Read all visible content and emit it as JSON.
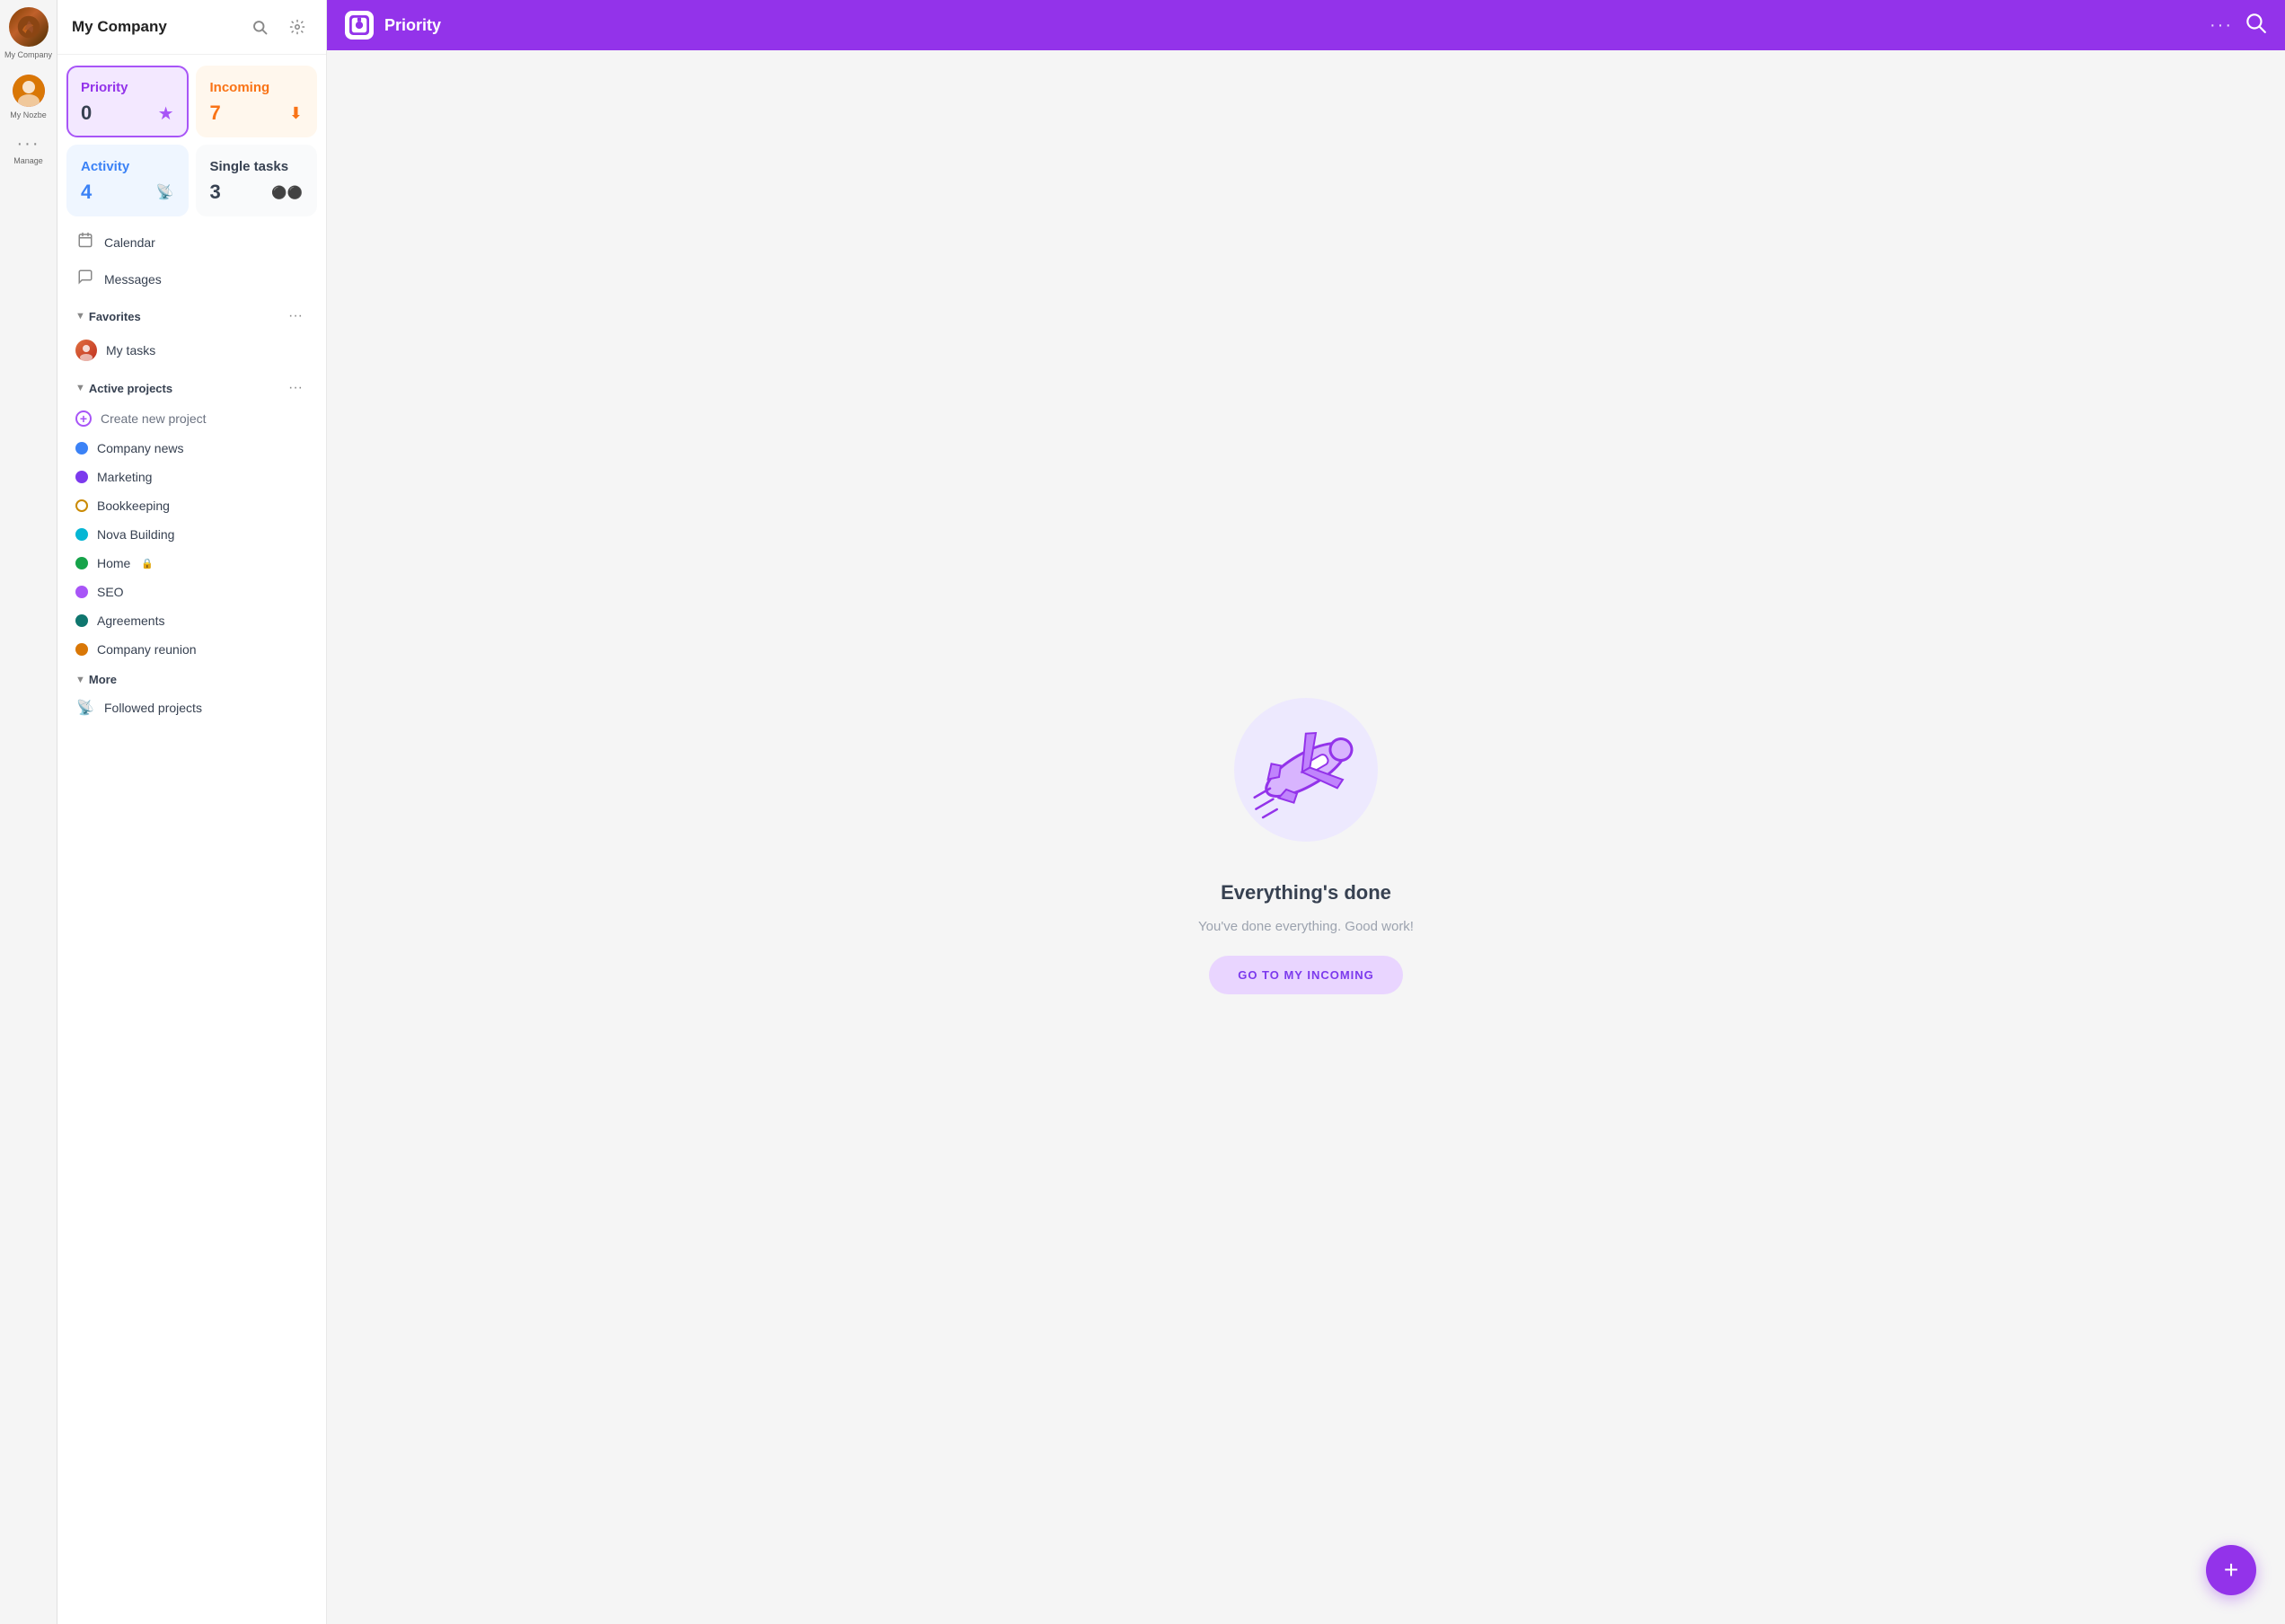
{
  "rail": {
    "company_label": "My Company",
    "user_label": "My Nozbe",
    "manage_label": "Manage"
  },
  "sidebar": {
    "title": "My Company",
    "search_label": "Search",
    "settings_label": "Settings",
    "cards": [
      {
        "id": "priority",
        "title": "Priority",
        "count": "0",
        "icon": "★",
        "type": "priority"
      },
      {
        "id": "incoming",
        "title": "Incoming",
        "count": "7",
        "icon": "⬇",
        "type": "incoming"
      },
      {
        "id": "activity",
        "title": "Activity",
        "count": "4",
        "icon": "📡",
        "type": "activity"
      },
      {
        "id": "single-tasks",
        "title": "Single tasks",
        "count": "3",
        "icon": "⚫",
        "type": "single"
      }
    ],
    "nav": [
      {
        "id": "calendar",
        "label": "Calendar",
        "icon": "📅"
      },
      {
        "id": "messages",
        "label": "Messages",
        "icon": "💬"
      }
    ],
    "favorites": {
      "label": "Favorites",
      "items": [
        {
          "id": "my-tasks",
          "label": "My tasks"
        }
      ]
    },
    "active_projects": {
      "label": "Active projects",
      "items": [
        {
          "id": "create-new",
          "label": "Create new project",
          "color": null
        },
        {
          "id": "company-news",
          "label": "Company news",
          "color": "#3b82f6"
        },
        {
          "id": "marketing",
          "label": "Marketing",
          "color": "#7c3aed"
        },
        {
          "id": "bookkeeping",
          "label": "Bookkeeping",
          "color": "#ca8a04"
        },
        {
          "id": "nova-building",
          "label": "Nova Building",
          "color": "#06b6d4"
        },
        {
          "id": "home",
          "label": "Home",
          "color": "#16a34a",
          "locked": true
        },
        {
          "id": "seo",
          "label": "SEO",
          "color": "#a855f7"
        },
        {
          "id": "agreements",
          "label": "Agreements",
          "color": "#0f766e"
        },
        {
          "id": "company-reunion",
          "label": "Company reunion",
          "color": "#d97706"
        }
      ]
    },
    "more": {
      "label": "More",
      "items": [
        {
          "id": "followed-projects",
          "label": "Followed projects",
          "icon": "📡"
        }
      ]
    }
  },
  "topbar": {
    "title": "Priority",
    "app_icon": "P"
  },
  "main": {
    "empty_title": "Everything's done",
    "empty_subtitle": "You've done everything. Good work!",
    "go_incoming_label": "GO TO MY INCOMING"
  },
  "fab": {
    "label": "+"
  }
}
